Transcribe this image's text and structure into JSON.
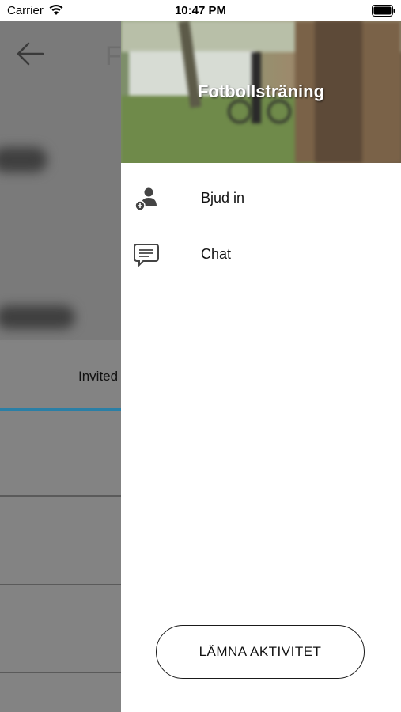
{
  "status_bar": {
    "carrier": "Carrier",
    "time": "10:47 PM",
    "icons": [
      "wifi-icon",
      "battery-icon"
    ]
  },
  "background_screen": {
    "title_fragment": "F",
    "tab_label": "Invited",
    "tab_accent_color": "#2a7fa6",
    "icons": [
      "back-arrow-icon"
    ]
  },
  "drawer": {
    "title": "Fotbollsträning",
    "menu": [
      {
        "label": "Bjud in",
        "icon": "add-person-icon"
      },
      {
        "label": "Chat",
        "icon": "chat-bubble-icon"
      }
    ],
    "leave_button": "LÄMNA AKTIVITET"
  }
}
